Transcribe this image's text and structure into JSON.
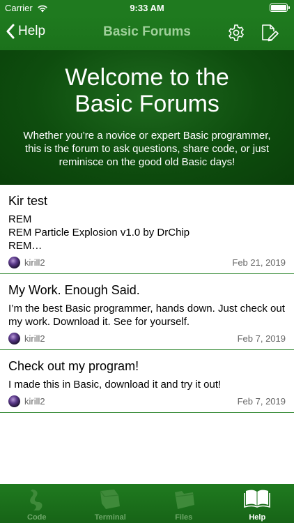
{
  "status_bar": {
    "carrier": "Carrier",
    "time": "9:33 AM"
  },
  "nav": {
    "back_label": "Help",
    "title": "Basic Forums",
    "settings_icon": "gear-icon",
    "compose_icon": "compose-icon"
  },
  "banner": {
    "title_line1": "Welcome to the",
    "title_line2": "Basic Forums",
    "subtitle": "Whether you’re a novice or expert Basic programmer, this is the forum to ask questions, share code, or just reminisce on the good old Basic days!"
  },
  "posts": [
    {
      "title": "Kir test",
      "body": "REM\nREM Particle Explosion v1.0 by DrChip\nREM…",
      "author": "kirill2",
      "date": "Feb 21, 2019"
    },
    {
      "title": "My Work. Enough Said.",
      "body": "I’m the best Basic programmer, hands down. Just check out my work. Download it. See for yourself.",
      "author": "kirill2",
      "date": "Feb 7, 2019"
    },
    {
      "title": "Check out my program!",
      "body": "I made this in Basic, download it and try it out!",
      "author": "kirill2",
      "date": "Feb 7, 2019"
    }
  ],
  "tabs": [
    {
      "label": "Code",
      "icon": "code-icon",
      "active": false
    },
    {
      "label": "Terminal",
      "icon": "terminal-icon",
      "active": false
    },
    {
      "label": "Files",
      "icon": "folder-icon",
      "active": false
    },
    {
      "label": "Help",
      "icon": "book-icon",
      "active": true
    }
  ],
  "colors": {
    "bar_green": "#1f7a1f",
    "banner_green": "#0e4d0e",
    "divider": "#3d8f3d"
  }
}
